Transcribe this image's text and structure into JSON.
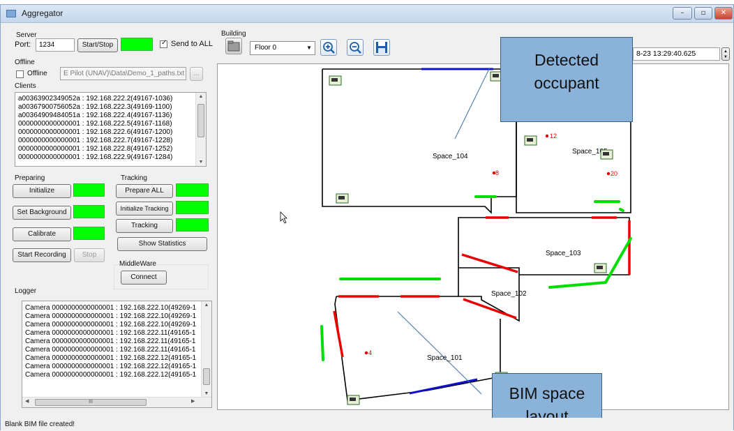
{
  "window": {
    "title": "Aggregator",
    "buttons": [
      "–",
      "▫",
      "✕"
    ]
  },
  "server": {
    "label": "Server",
    "port_label": "Port:",
    "port_value": "1234",
    "start_stop": "Start/Stop",
    "send_to_all_label": "Send to ALL",
    "send_to_all_checked": true,
    "status_color": "#00ff00"
  },
  "offline": {
    "label": "Offline",
    "checkbox_label": "Offline",
    "checked": false,
    "path_value": "E Pilot (UNAV)\\Data\\Demo_1_paths.txt",
    "browse": "..."
  },
  "clients": {
    "label": "Clients",
    "items": [
      "a00363902349052a : 192.168.222.2(49167-1036)",
      "a00367900756052a : 192.168.222.3(49169-1100)",
      "a00364909484051a : 192.168.222.4(49167-1136)",
      "0000000000000001 : 192.168.222.5(49167-1168)",
      "0000000000000001 : 192.168.222.6(49167-1200)",
      "0000000000000001 : 192.168.222.7(49167-1228)",
      "0000000000000001 : 192.168.222.8(49167-1252)",
      "0000000000000001 : 192.168.222.9(49167-1284)"
    ]
  },
  "preparing": {
    "label": "Preparing",
    "initialize": "Initialize",
    "set_background": "Set Background",
    "calibrate": "Calibrate",
    "start_recording": "Start Recording",
    "stop": "Stop"
  },
  "tracking": {
    "label": "Tracking",
    "prepare_all": "Prepare ALL",
    "initialize_tracking": "Initialize Tracking",
    "tracking": "Tracking",
    "show_statistics": "Show Statistics"
  },
  "middleware": {
    "label": "MiddleWare",
    "connect": "Connect"
  },
  "logger": {
    "label": "Logger",
    "items": [
      "Camera 0000000000000001 : 192.168.222.10(49269-1",
      "Camera 0000000000000001 : 192.168.222.10(49269-1",
      "Camera 0000000000000001 : 192.168.222.10(49269-1",
      "Camera 0000000000000001 : 192.168.222.11(49165-1",
      "Camera 0000000000000001 : 192.168.222.11(49165-1",
      "Camera 0000000000000001 : 192.168.222.11(49165-1",
      "Camera 0000000000000001 : 192.168.222.12(49165-1",
      "Camera 0000000000000001 : 192.168.222.12(49165-1",
      "Camera 0000000000000001 : 192.168.222.12(49165-1"
    ],
    "hscroll_grip": "III"
  },
  "building": {
    "label": "Building",
    "floor_value": "Floor 0",
    "timestamp_value": "8-23 13:29:40.625"
  },
  "map": {
    "spaces": [
      "Space_104",
      "Space_105",
      "Space_103",
      "Space_102",
      "Space_101"
    ],
    "occupants": [
      "12",
      "8",
      "20",
      "4"
    ]
  },
  "callouts": {
    "detected": "Detected occupant",
    "detected_line1": "Detected",
    "detected_line2": "occupant",
    "bim_line1": "BIM space",
    "bim_line2": "layout"
  },
  "status": "Blank BIM file created!",
  "colors": {
    "status_green": "#00ff00",
    "door_red": "#ff0000",
    "window_blue": "#0000cc",
    "callout_fill": "#8bb3d9"
  }
}
